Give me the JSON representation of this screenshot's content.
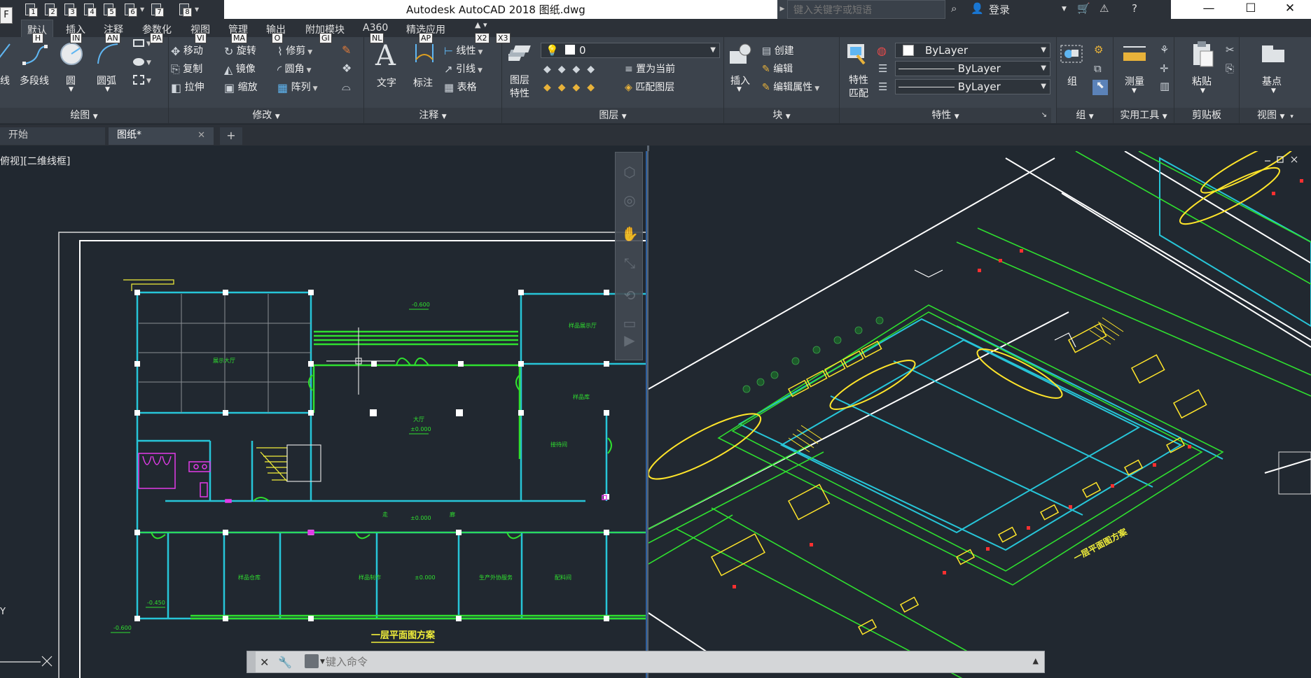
{
  "app": {
    "app_button": "F",
    "title": "Autodesk AutoCAD 2018      图纸.dwg"
  },
  "qat": {
    "keys": [
      "1",
      "2",
      "3",
      "4",
      "5",
      "6",
      "7",
      "8"
    ]
  },
  "search": {
    "placeholder": "键入关键字或短语"
  },
  "user": {
    "login": "登录"
  },
  "ribbon_tabs": [
    {
      "label": "默认",
      "key": "H"
    },
    {
      "label": "插入",
      "key": "IN"
    },
    {
      "label": "注释",
      "key": "AN"
    },
    {
      "label": "参数化",
      "key": "PA"
    },
    {
      "label": "视图",
      "key": "VI"
    },
    {
      "label": "管理",
      "key": "MA"
    },
    {
      "label": "输出",
      "key": "O"
    },
    {
      "label": "附加模块",
      "key": "GI"
    },
    {
      "label": "A360",
      "key": "NL"
    },
    {
      "label": "精选应用",
      "key": "AP"
    }
  ],
  "extra_keys": [
    "X2",
    "X3"
  ],
  "panels": {
    "draw": {
      "title": "绘图",
      "line": "线",
      "polyline": "多段线",
      "circle": "圆",
      "arc": "圆弧"
    },
    "modify": {
      "title": "修改",
      "move": "移动",
      "rotate": "旋转",
      "trim": "修剪",
      "copy": "复制",
      "mirror": "镜像",
      "fillet": "圆角",
      "stretch": "拉伸",
      "scale": "缩放",
      "array": "阵列"
    },
    "annotation": {
      "title": "注释",
      "text": "文字",
      "dimension": "标注",
      "linear": "线性",
      "leader": "引线",
      "table": "表格"
    },
    "layers": {
      "title": "图层",
      "layer_props_1": "图层",
      "layer_props_2": "特性",
      "layer_value": "0",
      "set_current": "置为当前",
      "match_layer": "匹配图层"
    },
    "block": {
      "title": "块",
      "insert": "插入",
      "create": "创建",
      "edit": "编辑",
      "edit_attr": "编辑属性"
    },
    "properties": {
      "title": "特性",
      "match_1": "特性",
      "match_2": "匹配",
      "color": "ByLayer",
      "linetype": "ByLayer",
      "lineweight": "ByLayer"
    },
    "groups": {
      "title": "组",
      "group": "组"
    },
    "utilities": {
      "title": "实用工具",
      "measure": "测量"
    },
    "clipboard": {
      "title": "剪贴板",
      "paste": "粘贴"
    },
    "view": {
      "title": "视图",
      "base": "基点"
    }
  },
  "file_tabs": {
    "start": "开始",
    "drawing": "图纸*",
    "add": "+"
  },
  "viewport": {
    "label": "俯视][二维线框]"
  },
  "drawing": {
    "plan_title": "一层平面图方案",
    "iso_title": "一层平面图方案",
    "rooms": [
      "展示大厅",
      "大厅",
      "样品展示厅",
      "样品库",
      "接待间",
      "样品制作",
      "生产外协服务",
      "配料间",
      "样品仓库"
    ],
    "elev_labels": [
      "±0.000",
      "±0.000",
      "±0.000",
      "-0.600",
      "-0.450",
      "-0.600"
    ],
    "corridor_label_1": "走",
    "corridor_label_2": "廊"
  },
  "command": {
    "placeholder": "键入命令"
  },
  "colors": {
    "wall_cyan": "#27c5d8",
    "wall_green": "#2fe02f",
    "text_yellow": "#f2ef3a",
    "furniture_yellow": "#ffe52a",
    "accent_red": "#ff3030",
    "magenta": "#e23be8",
    "column_white": "#ffffff"
  }
}
